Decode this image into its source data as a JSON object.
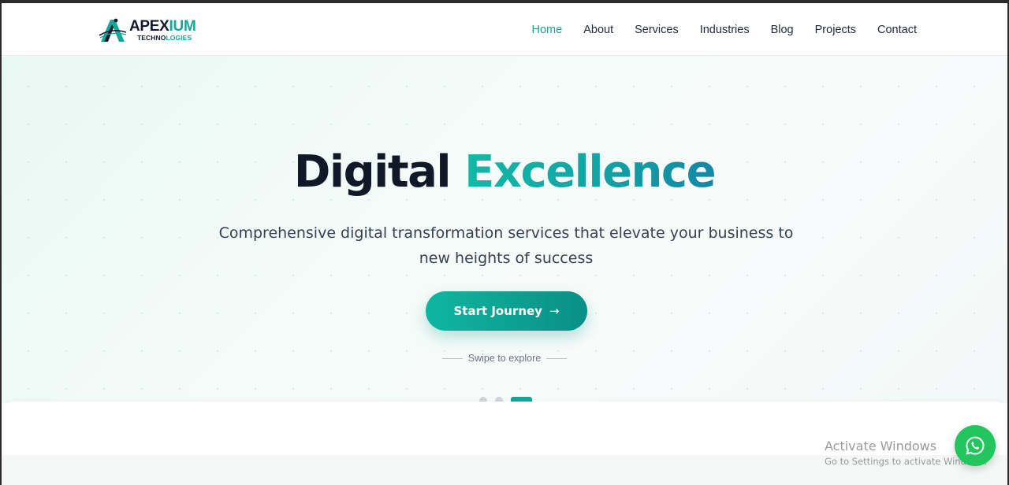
{
  "brand": {
    "name_dark": "APEX",
    "name_teal": "IUM",
    "sub_dark": "TECHNO",
    "sub_teal": "LOGIES",
    "logo_icon": "apexium-a-mark-icon",
    "color_teal": "#16a79b",
    "color_dark": "#121a2a"
  },
  "nav": {
    "items": [
      {
        "label": "Home",
        "active": true
      },
      {
        "label": "About",
        "active": false
      },
      {
        "label": "Services",
        "active": false
      },
      {
        "label": "Industries",
        "active": false
      },
      {
        "label": "Blog",
        "active": false
      },
      {
        "label": "Projects",
        "active": false
      },
      {
        "label": "Contact",
        "active": false
      }
    ],
    "active_color": "#1a9e93"
  },
  "hero": {
    "title_plain": "Digital",
    "title_accent": "Excellence",
    "subtitle_line1": "Comprehensive digital transformation services that elevate your business to",
    "subtitle_line2": "new heights of success",
    "cta_label": "Start Journey",
    "cta_icon": "arrow-right-icon",
    "swipe_text": "Swipe to explore",
    "slides_total": 3,
    "slide_active": 3,
    "accent_color": "#12a796"
  },
  "watermark": {
    "title": "Activate Windows",
    "subtitle": "Go to Settings to activate Windows."
  },
  "whatsapp": {
    "icon": "whatsapp-icon",
    "color": "#22c55e"
  }
}
